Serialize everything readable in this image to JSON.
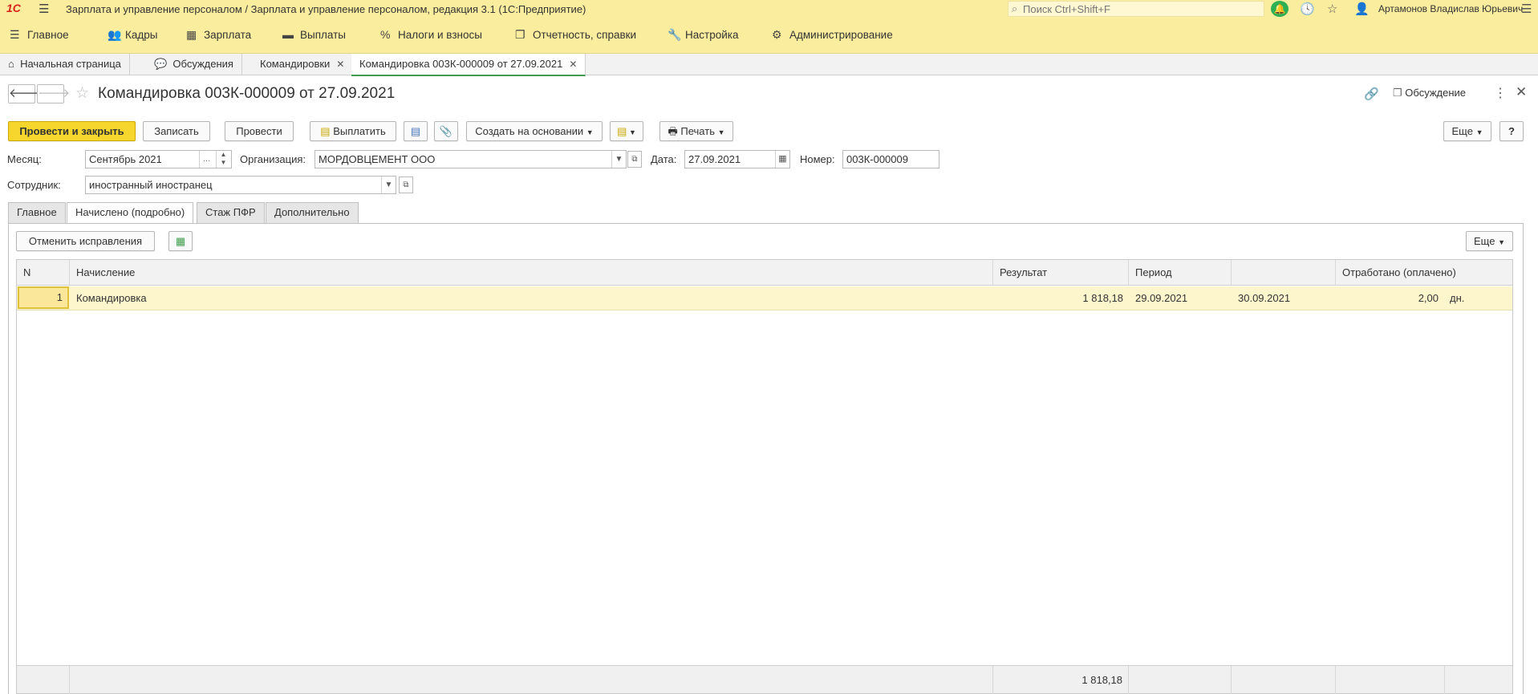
{
  "app": {
    "title": "Зарплата и управление персоналом / Зарплата и управление персоналом, редакция 3.1  (1С:Предприятие)",
    "logo_text": "1С",
    "search_placeholder": "Поиск Ctrl+Shift+F",
    "user_name": "Артамонов Владислав Юрьевич"
  },
  "sections": [
    {
      "label": "Главное",
      "icon": "menu-icon"
    },
    {
      "label": "Кадры",
      "icon": "people-icon"
    },
    {
      "label": "Зарплата",
      "icon": "calculator-icon"
    },
    {
      "label": "Выплаты",
      "icon": "wallet-icon"
    },
    {
      "label": "Налоги и взносы",
      "icon": "percent-icon"
    },
    {
      "label": "Отчетность, справки",
      "icon": "reports-icon"
    },
    {
      "label": "Настройка",
      "icon": "wrench-icon"
    },
    {
      "label": "Администрирование",
      "icon": "gear-icon"
    }
  ],
  "open_tabs": [
    {
      "label": "Начальная страница"
    },
    {
      "label": "Обсуждения"
    },
    {
      "label": "Командировки"
    },
    {
      "label": "Командировка 003К-000009 от 27.09.2021"
    }
  ],
  "document": {
    "title": "Командировка 003К-000009 от 27.09.2021",
    "discussion_label": "Обсуждение"
  },
  "toolbar": {
    "post_close": "Провести и закрыть",
    "save": "Записать",
    "post": "Провести",
    "pay": "Выплатить",
    "create_based": "Создать на основании",
    "print": "Печать",
    "more": "Еще",
    "help": "?"
  },
  "fields": {
    "month_label": "Месяц:",
    "month_value": "Сентябрь 2021",
    "org_label": "Организация:",
    "org_value": "МОРДОВЦЕМЕНТ ООО",
    "date_label": "Дата:",
    "date_value": "27.09.2021",
    "number_label": "Номер:",
    "number_value": "003К-000009",
    "employee_label": "Сотрудник:",
    "employee_value": "иностранный иностранец"
  },
  "form_tabs": [
    {
      "label": "Главное"
    },
    {
      "label": "Начислено (подробно)"
    },
    {
      "label": "Стаж ПФР"
    },
    {
      "label": "Дополнительно"
    }
  ],
  "table_toolbar": {
    "cancel_fixes": "Отменить исправления",
    "more": "Еще"
  },
  "table": {
    "columns": [
      "N",
      "Начисление",
      "Результат",
      "Период",
      "",
      "Отработано (оплачено)"
    ],
    "rows": [
      {
        "n": "1",
        "accrual": "Командировка",
        "result": "1 818,18",
        "period_from": "29.09.2021",
        "period_to": "30.09.2021",
        "worked": "2,00",
        "unit": "дн."
      }
    ],
    "total_result": "1 818,18"
  }
}
